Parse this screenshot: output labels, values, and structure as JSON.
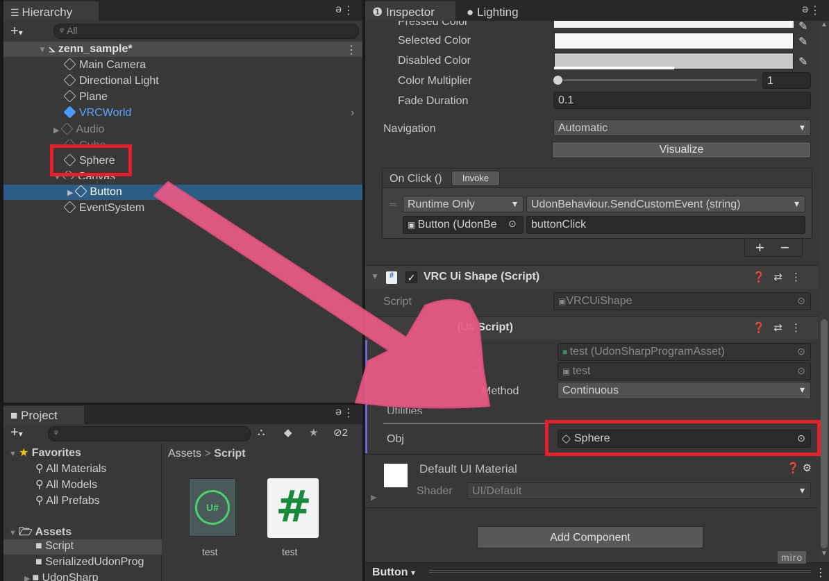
{
  "hierarchy": {
    "tab": "Hierarchy",
    "search_placeholder": "All",
    "scene": "zenn_sample*",
    "items": [
      "Main Camera",
      "Directional Light",
      "Plane",
      "VRCWorld",
      "Audio",
      "Cube",
      "Sphere",
      "Canvas",
      "Button",
      "EventSystem"
    ]
  },
  "project": {
    "tab": "Project",
    "hidden_count": "2",
    "favorites": "Favorites",
    "fav_items": [
      "All Materials",
      "All Models",
      "All Prefabs"
    ],
    "assets": "Assets",
    "folders": [
      "Script",
      "SerializedUdonProg",
      "UdonSharp"
    ],
    "breadcrumb_root": "Assets",
    "breadcrumb_sep": ">",
    "breadcrumb_current": "Script",
    "files": [
      "test",
      "test"
    ],
    "file_glyph": "#",
    "udon_glyph": "U#"
  },
  "inspector": {
    "tab": "Inspector",
    "tab2": "Lighting",
    "pressed_color": "Pressed Color",
    "selected_color": "Selected Color",
    "disabled_color": "Disabled Color",
    "color_multiplier": "Color Multiplier",
    "color_multiplier_value": "1",
    "fade_duration": "Fade Duration",
    "fade_value": "0.1",
    "navigation": "Navigation",
    "navigation_value": "Automatic",
    "visualize": "Visualize",
    "onclick": "On Click ()",
    "invoke": "Invoke",
    "runtime": "Runtime Only",
    "function": "UdonBehaviour.SendCustomEvent (string)",
    "target": "Button (UdonBe",
    "arg": "buttonClick",
    "plus": "+",
    "minus": "−",
    "vrc_shape": "VRC Ui Shape (Script)",
    "script_label": "Script",
    "vrc_script": "VRCUiShape",
    "usharp_title": "(U# Script)",
    "prog_label": "ce",
    "prog_value": "test (UdonSharpProgramAsset)",
    "src_label": "pt",
    "src_value": "test",
    "sync_label": "Method",
    "sync_value": "Continuous",
    "utilities": "Utilities",
    "obj_label": "Obj",
    "obj_value": "Sphere",
    "material": "Default UI Material",
    "shader_label": "Shader",
    "shader_value": "UI/Default",
    "add_component": "Add Component",
    "bottom_tab": "Button"
  },
  "watermark": "miro",
  "colors": {
    "accent_red": "#e8202a",
    "arrow_pink": "#e85a85",
    "selection": "#2c5d87"
  }
}
